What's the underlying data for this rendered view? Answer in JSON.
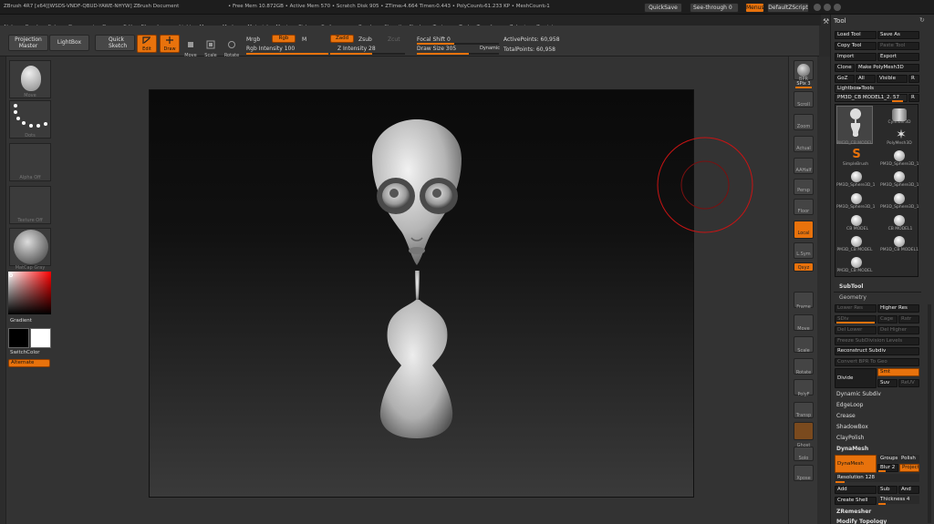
{
  "titlebar": {
    "title": "ZBrush 4R7 [x64][WSDS-VNDF-QBUD-YAWE-NHYW]   ZBrush Document",
    "stats": "• Free Mem 10.872GB • Active Mem 570 • Scratch Disk 905 • ZTime▹4.664 Timer▹0.443 • PolyCount▹61.233 KP • MeshCount▹1",
    "quicksave": "QuickSave",
    "seethrough": "See-through  0",
    "menus": "Menus",
    "defaultzscript": "DefaultZScript"
  },
  "menubar": [
    "Alpha",
    "Brush",
    "Color",
    "Document",
    "Draw",
    "Edit",
    "File",
    "Layer",
    "Light",
    "Macro",
    "Marker",
    "Material",
    "Movie",
    "Picker",
    "Preferences",
    "Render",
    "Stencil",
    "Stroke",
    "Texture",
    "Tool",
    "Transform",
    "Zplugin",
    "Zscript"
  ],
  "toolbar": {
    "projection_master": "Projection Master",
    "lightbox": "LightBox",
    "quick_sketch": "Quick Sketch",
    "edit": "Edit",
    "draw": "Draw",
    "move": "Move",
    "scale": "Scale",
    "rotate": "Rotate",
    "mrgb": "Mrgb",
    "rgb": "Rgb",
    "m": "M",
    "rgb_intensity": "Rgb Intensity 100",
    "zadd": "Zadd",
    "zsub": "Zsub",
    "zcut": "Zcut",
    "z_intensity": "Z Intensity 28",
    "focal_shift": "Focal Shift 0",
    "draw_size": "Draw Size 305",
    "dynamic": "Dynamic",
    "active_points": "ActivePoints: 60,958",
    "total_points": "TotalPoints: 60,958"
  },
  "leftshelf": {
    "brush": "Move",
    "stroke": "Dots",
    "alpha": "Alpha Off",
    "texture": "Texture Off",
    "material": "MatCap Gray",
    "gradient": "Gradient",
    "switchcolor": "SwitchColor",
    "alternate": "Alternate"
  },
  "rightshelf": [
    "BPR",
    "SPix 3",
    "Scroll",
    "Zoom",
    "Actual",
    "AAHalf",
    "Persp",
    "Floor",
    "Local",
    "L.Sym",
    "Qxyz",
    "Frame",
    "Move",
    "Scale",
    "Rotate",
    "PolyF",
    "Transp",
    "Ghost",
    "Solo",
    "Xpose"
  ],
  "toolpanel": {
    "title": "Tool",
    "load_tool": "Load Tool",
    "save_as": "Save As",
    "copy_tool": "Copy Tool",
    "paste_tool": "Paste Tool",
    "import": "Import",
    "export": "Export",
    "clone": "Clone",
    "make_polymesh": "Make PolyMesh3D",
    "goz": "GoZ",
    "all": "All",
    "visible": "Visible",
    "r": "R",
    "lightbox_tools": "Lightbox▸Tools",
    "current_tool": "PM3D_CB MODEL1_2. 57",
    "tools": [
      "PM3D_CB MODEL",
      "Cylinder3D",
      "",
      "PolyMesh3D",
      "SimpleBrush",
      "PM3D_Sphere3D_1",
      "PM3D_Sphere3D_1",
      "PM3D_Sphere3D_1",
      "CB MODEL",
      "CB MODEL1",
      "PM3D_CB MODEL",
      "PM3D_CB MODEL1",
      "PM3D_CB MODEL"
    ],
    "subtool": "SubTool",
    "geometry": "Geometry",
    "lower_res": "Lower Res",
    "higher_res": "Higher Res",
    "sdiv": "SDiv",
    "cage": "Cage",
    "rstr": "Rstr",
    "del_lower": "Del Lower",
    "del_higher": "Del Higher",
    "freeze": "Freeze SubDivision Levels",
    "reconstruct": "Reconstruct Subdiv",
    "convert_bpr": "Convert BPR To Geo",
    "divide": "Divide",
    "smt": "Smt",
    "suv": "Suv",
    "reuv": "ReUV",
    "dynamic_subdiv": "Dynamic Subdiv",
    "edgeloop": "EdgeLoop",
    "crease": "Crease",
    "shadowbox": "ShadowBox",
    "claypolish": "ClayPolish",
    "dynamesh": "DynaMesh",
    "dynamesh_btn": "DynaMesh",
    "groups": "Groups",
    "polish": "Polish",
    "blur": "Blur 2",
    "project": "Project",
    "resolution": "Resolution 128",
    "add": "Add",
    "sub": "Sub",
    "and": "And",
    "create_shell": "Create Shell",
    "thickness": "Thickness 4",
    "zremesher": "ZRemesher",
    "modify_topology": "Modify Topology"
  },
  "colors": {
    "accent": "#e8720c",
    "background": "#2a2a2a",
    "cursor_ring": "#c81414"
  }
}
